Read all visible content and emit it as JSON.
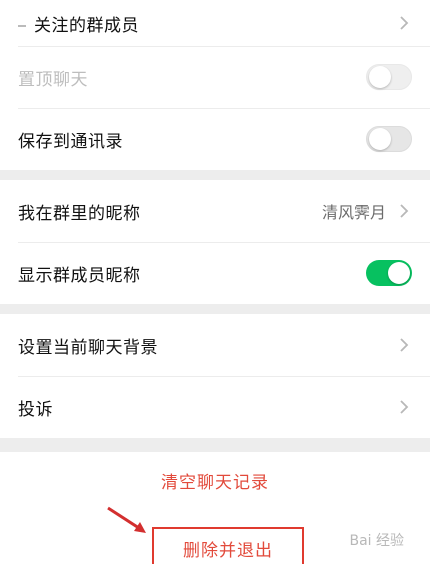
{
  "rows": {
    "focus_members": {
      "label": "关注的群成员"
    },
    "pin_chat": {
      "label": "置顶聊天",
      "toggle": "off",
      "disabled": true
    },
    "save_contacts": {
      "label": "保存到通讯录",
      "toggle": "off"
    },
    "my_nickname": {
      "label": "我在群里的昵称",
      "value": "清风霁月"
    },
    "show_nicknames": {
      "label": "显示群成员昵称",
      "toggle": "on"
    },
    "set_background": {
      "label": "设置当前聊天背景"
    },
    "complain": {
      "label": "投诉"
    }
  },
  "actions": {
    "clear_history": "清空聊天记录",
    "delete_and_exit": "删除并退出"
  },
  "watermark": "Bai 经验",
  "colors": {
    "accent_green": "#07c160",
    "danger_red": "#e24a3b",
    "background": "#ededed"
  }
}
